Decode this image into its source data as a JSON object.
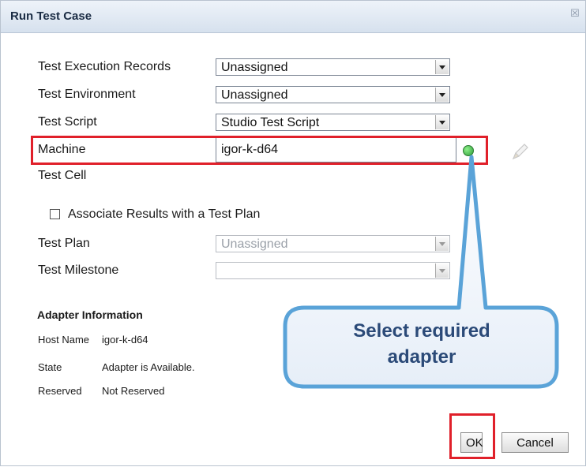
{
  "dialog": {
    "title": "Run Test Case",
    "close_glyph": "☒"
  },
  "fields": {
    "execution_records": {
      "label": "Test Execution Records",
      "value": "Unassigned"
    },
    "environment": {
      "label": "Test Environment",
      "value": "Unassigned"
    },
    "script": {
      "label": "Test Script",
      "value": "Studio Test Script"
    },
    "machine": {
      "label": "Machine",
      "value": "igor-k-d64"
    },
    "test_cell": {
      "label": "Test Cell"
    },
    "associate": {
      "label": "Associate Results with a Test Plan",
      "checked": false
    },
    "plan": {
      "label": "Test Plan",
      "value": "Unassigned"
    },
    "milestone": {
      "label": "Test Milestone",
      "value": ""
    }
  },
  "adapter_info": {
    "title": "Adapter Information",
    "host_name_label": "Host Name",
    "host_name_value": "igor-k-d64",
    "state_label": "State",
    "state_value": "Adapter is Available.",
    "reserved_label": "Reserved",
    "reserved_value": "Not Reserved"
  },
  "buttons": {
    "ok": "OK",
    "cancel": "Cancel"
  },
  "callout": {
    "line1": "Select required",
    "line2": "adapter"
  },
  "colors": {
    "highlight": "#e0202a",
    "callout_border": "#5aa3d8",
    "callout_text": "#2b4a78",
    "status_dot": "#2e9d3a"
  },
  "icons": {
    "status": "green-status-dot-icon",
    "edit": "pencil-icon",
    "close": "close-icon",
    "dropdown": "chevron-down-icon"
  }
}
